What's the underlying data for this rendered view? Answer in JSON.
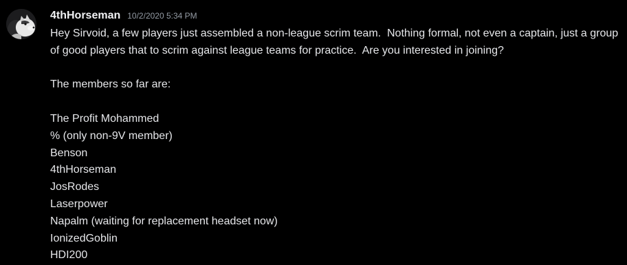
{
  "author": {
    "username": "4thHorseman",
    "timestamp": "10/2/2020 5:34 PM",
    "avatar_icon": "husky-dog-avatar"
  },
  "message": {
    "intro": "Hey Sirvoid, a few players just assembled a non-league scrim team.  Nothing formal, not even a captain, just a group of good players that to scrim against league teams for practice.  Are you interested in joining?",
    "members_heading": "The members so far are:",
    "members": [
      "The Profit Mohammed",
      "% (only non-9V member)",
      "Benson",
      "4thHorseman",
      "JosRodes",
      "Laserpower",
      "Napalm (waiting for replacement headset now)",
      "IonizedGoblin",
      "HDI200"
    ]
  },
  "colors": {
    "background": "#000000",
    "username": "#f2f3f5",
    "timestamp": "#949ba4",
    "text": "#e6e7ea"
  }
}
